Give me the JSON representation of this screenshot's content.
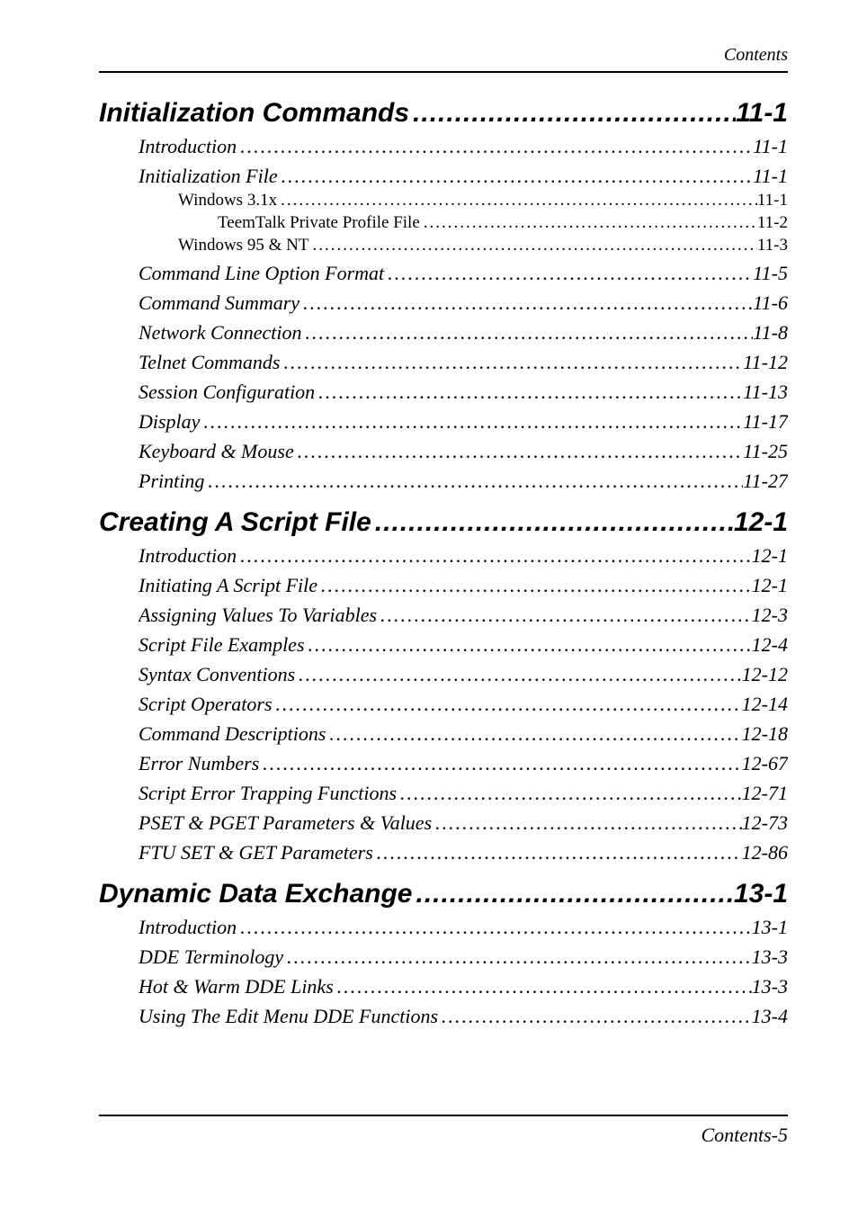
{
  "header": "Contents",
  "footer": "Contents-5",
  "entries": [
    {
      "level": "chapter",
      "label": "Initialization Commands",
      "page": "11-1"
    },
    {
      "level": "section",
      "label": "Introduction",
      "page": "11-1"
    },
    {
      "level": "section",
      "label": "Initialization File",
      "page": "11-1"
    },
    {
      "level": "sub",
      "label": "Windows 3.1x",
      "page": "11-1"
    },
    {
      "level": "subsub",
      "label": "TeemTalk Private Profile File",
      "page": "11-2"
    },
    {
      "level": "sub",
      "label": "Windows 95 & NT",
      "page": "11-3"
    },
    {
      "level": "section",
      "label": "Command Line Option Format",
      "page": "11-5"
    },
    {
      "level": "section",
      "label": "Command Summary",
      "page": "11-6"
    },
    {
      "level": "section",
      "label": "Network Connection",
      "page": "11-8"
    },
    {
      "level": "section",
      "label": "Telnet Commands",
      "page": "11-12"
    },
    {
      "level": "section",
      "label": "Session Configuration",
      "page": "11-13"
    },
    {
      "level": "section",
      "label": "Display",
      "page": "11-17"
    },
    {
      "level": "section",
      "label": "Keyboard & Mouse",
      "page": "11-25"
    },
    {
      "level": "section",
      "label": "Printing",
      "page": "11-27"
    },
    {
      "level": "chapter",
      "label": "Creating A Script File",
      "page": "12-1"
    },
    {
      "level": "section",
      "label": "Introduction",
      "page": "12-1"
    },
    {
      "level": "section",
      "label": "Initiating A Script File",
      "page": "12-1"
    },
    {
      "level": "section",
      "label": "Assigning Values To Variables",
      "page": "12-3"
    },
    {
      "level": "section",
      "label": "Script File Examples",
      "page": "12-4"
    },
    {
      "level": "section",
      "label": "Syntax Conventions",
      "page": "12-12"
    },
    {
      "level": "section",
      "label": "Script Operators",
      "page": "12-14"
    },
    {
      "level": "section",
      "label": "Command Descriptions",
      "page": "12-18"
    },
    {
      "level": "section",
      "label": "Error Numbers",
      "page": "12-67"
    },
    {
      "level": "section",
      "label": "Script Error Trapping Functions",
      "page": "12-71"
    },
    {
      "level": "section",
      "label": "PSET & PGET Parameters & Values",
      "page": "12-73"
    },
    {
      "level": "section",
      "label": "FTU SET & GET Parameters",
      "page": "12-86"
    },
    {
      "level": "chapter",
      "label": "Dynamic Data Exchange",
      "page": "13-1"
    },
    {
      "level": "section",
      "label": "Introduction",
      "page": "13-1"
    },
    {
      "level": "section",
      "label": "DDE Terminology",
      "page": "13-3"
    },
    {
      "level": "section",
      "label": "Hot & Warm DDE Links",
      "page": "13-3"
    },
    {
      "level": "section",
      "label": "Using The Edit Menu DDE Functions",
      "page": "13-4"
    }
  ]
}
